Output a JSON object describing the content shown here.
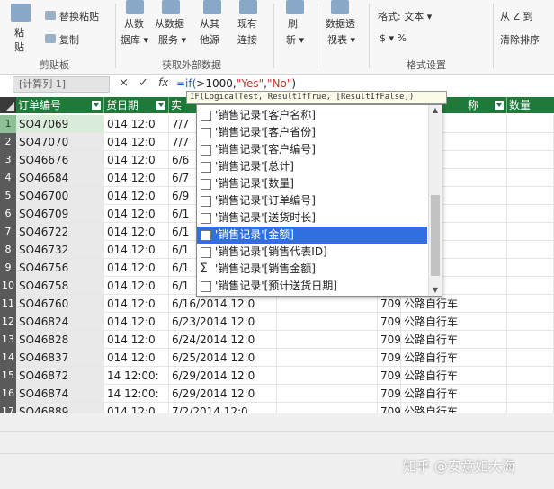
{
  "ribbon": {
    "paste": [
      "粘",
      "贴"
    ],
    "paste_replace": "替换粘贴",
    "copy": "复制",
    "clipboard_label": "剪贴板",
    "from_db": [
      "从数",
      "据库 ▾"
    ],
    "from_service": [
      "从数据",
      "服务 ▾"
    ],
    "from_other": [
      "从其",
      "他源"
    ],
    "existing": [
      "现有",
      "连接"
    ],
    "external_label": "获取外部数据",
    "refresh": [
      "刷",
      "新 ▾"
    ],
    "pivot": [
      "数据透",
      "视表 ▾"
    ],
    "format": "格式: 文本 ▾",
    "currency": "$ ▾ %",
    "format_label": "格式设置",
    "sort_az": "从 Z 到",
    "clear_sort": "清除排序"
  },
  "formula_bar": {
    "name_box": "[计算列 1]",
    "cancel": "×",
    "enter": "✓",
    "fx": "fx",
    "formula_prefix": "=if(",
    "formula_mid": ">1000,",
    "formula_yes": "\"Yes\"",
    "formula_comma": ",",
    "formula_no": "\"No\"",
    "formula_end": ")"
  },
  "columns": {
    "order_no": "订单编号",
    "date": "货日期",
    "date2": "实",
    "name": "称",
    "qty": "数量"
  },
  "rows": [
    {
      "n": "1",
      "id": "SO47069",
      "d1": "014 12:0",
      "d2": "7/7",
      "num": "",
      "cat": "行车"
    },
    {
      "n": "2",
      "id": "SO47070",
      "d1": "014 12:0",
      "d2": "7/7",
      "num": "",
      "cat": "行车"
    },
    {
      "n": "3",
      "id": "SO46676",
      "d1": "014 12:0",
      "d2": "6/6",
      "num": "",
      "cat": "行车"
    },
    {
      "n": "4",
      "id": "SO46684",
      "d1": "014 12:0",
      "d2": "6/7",
      "num": "",
      "cat": "行车"
    },
    {
      "n": "5",
      "id": "SO46700",
      "d1": "014 12:0",
      "d2": "6/9",
      "num": "",
      "cat": "行车"
    },
    {
      "n": "6",
      "id": "SO46709",
      "d1": "014 12:0",
      "d2": "6/1",
      "num": "",
      "cat": "行车"
    },
    {
      "n": "7",
      "id": "SO46722",
      "d1": "014 12:0",
      "d2": "6/1",
      "num": "",
      "cat": "行车"
    },
    {
      "n": "8",
      "id": "SO46732",
      "d1": "014 12:0",
      "d2": "6/1",
      "num": "",
      "cat": "行车"
    },
    {
      "n": "9",
      "id": "SO46756",
      "d1": "014 12:0",
      "d2": "6/1",
      "num": "",
      "cat": "行车"
    },
    {
      "n": "10",
      "id": "SO46758",
      "d1": "014 12:0",
      "d2": "6/1",
      "num": "",
      "cat": "行车"
    },
    {
      "n": "11",
      "id": "SO46760",
      "d1": "014 12:0",
      "d2": "6/16/2014 12:0",
      "num": "709",
      "cat": "公路自行车"
    },
    {
      "n": "12",
      "id": "SO46824",
      "d1": "014 12:0",
      "d2": "6/23/2014 12:0",
      "num": "709",
      "cat": "公路自行车"
    },
    {
      "n": "13",
      "id": "SO46828",
      "d1": "014 12:0",
      "d2": "6/24/2014 12:0",
      "num": "709",
      "cat": "公路自行车"
    },
    {
      "n": "14",
      "id": "SO46837",
      "d1": "014 12:0",
      "d2": "6/25/2014 12:0",
      "num": "709",
      "cat": "公路自行车"
    },
    {
      "n": "15",
      "id": "SO46872",
      "d1": "14 12:00:",
      "d2": "6/29/2014 12:0",
      "num": "709",
      "cat": "公路自行车"
    },
    {
      "n": "16",
      "id": "SO46874",
      "d1": "14 12:00:",
      "d2": "6/29/2014 12:0",
      "num": "709",
      "cat": "公路自行车"
    },
    {
      "n": "17",
      "id": "SO46889",
      "d1": "014 12:0",
      "d2": "7/2/2014 12:0",
      "num": "709",
      "cat": "公路自行车"
    }
  ],
  "autocomplete": {
    "tooltip": "IF(LogicalTest, ResultIfTrue, [ResultIfFalse])",
    "items": [
      {
        "label": "'销售记录'[客户名称]",
        "icon": "box"
      },
      {
        "label": "'销售记录'[客户省份]",
        "icon": "box"
      },
      {
        "label": "'销售记录'[客户编号]",
        "icon": "box"
      },
      {
        "label": "'销售记录'[总计]",
        "icon": "box"
      },
      {
        "label": "'销售记录'[数量]",
        "icon": "box"
      },
      {
        "label": "'销售记录'[订单编号]",
        "icon": "box"
      },
      {
        "label": "'销售记录'[送货时长]",
        "icon": "box"
      },
      {
        "label": "'销售记录'[金额]",
        "icon": "box",
        "selected": true
      },
      {
        "label": "'销售记录'[销售代表ID]",
        "icon": "box"
      },
      {
        "label": "'销售记录'[销售金额]",
        "icon": "sum"
      },
      {
        "label": "'销售记录'[预计送货日期]",
        "icon": "box"
      }
    ]
  },
  "watermark": "知乎 @安意如大海"
}
